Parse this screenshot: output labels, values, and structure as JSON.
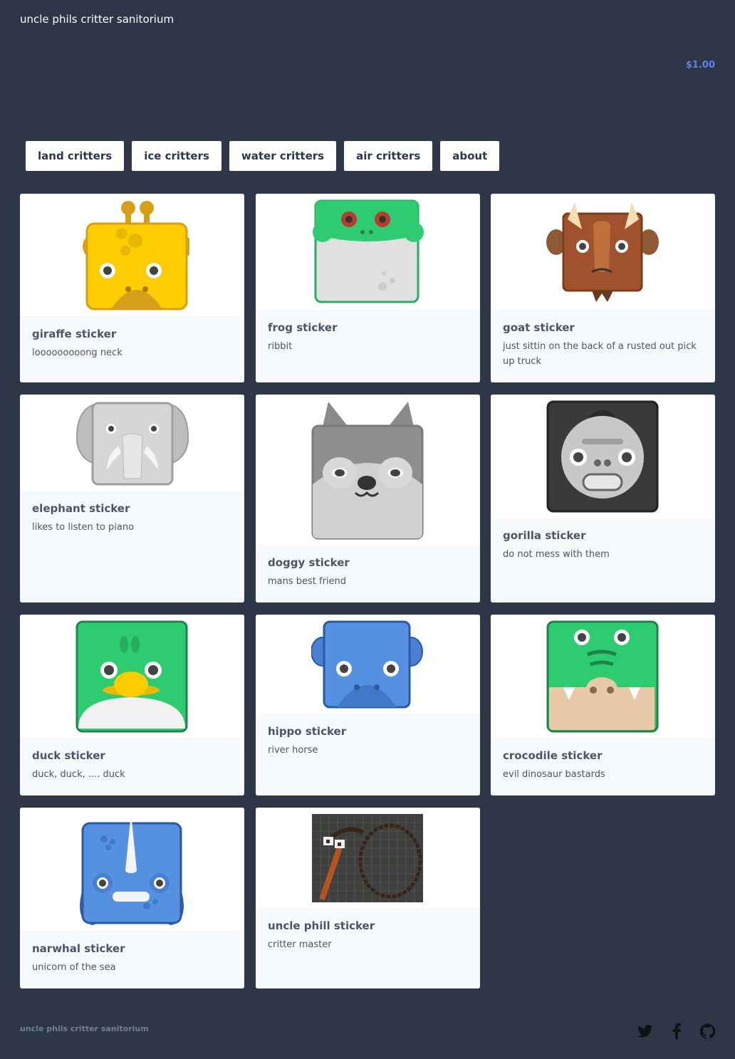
{
  "header": {
    "title": "uncle phils critter sanitorium",
    "cart_total": "$1.00"
  },
  "nav": [
    {
      "label": "land critters"
    },
    {
      "label": "ice critters"
    },
    {
      "label": "water critters"
    },
    {
      "label": "air critters"
    },
    {
      "label": "about"
    }
  ],
  "products": [
    {
      "name": "giraffe sticker",
      "description": "looooooooong neck",
      "icon": "giraffe-icon"
    },
    {
      "name": "frog sticker",
      "description": "ribbit",
      "icon": "frog-icon"
    },
    {
      "name": "goat sticker",
      "description": "just sittin on the back of a rusted out pick up truck",
      "icon": "goat-icon"
    },
    {
      "name": "elephant sticker",
      "description": "likes to listen to piano",
      "icon": "elephant-icon"
    },
    {
      "name": "doggy sticker",
      "description": "mans best friend",
      "icon": "dog-icon"
    },
    {
      "name": "gorilla sticker",
      "description": "do not mess with them",
      "icon": "gorilla-icon"
    },
    {
      "name": "duck sticker",
      "description": "duck, duck, .... duck",
      "icon": "duck-icon"
    },
    {
      "name": "hippo sticker",
      "description": "river horse",
      "icon": "hippo-icon"
    },
    {
      "name": "crocodile sticker",
      "description": "evil dinosaur bastards",
      "icon": "crocodile-icon"
    },
    {
      "name": "narwhal sticker",
      "description": "unicorn of the sea",
      "icon": "narwhal-icon"
    },
    {
      "name": "uncle phill sticker",
      "description": "critter master",
      "icon": "uncle-phill-pixel-art"
    }
  ],
  "footer": {
    "title": "uncle phils critter sanitorium",
    "social_icons": [
      "twitter-icon",
      "facebook-icon",
      "github-icon"
    ]
  },
  "colors": {
    "background": "#2d3748",
    "accent": "#667eea",
    "card_info_bg": "#f7fafc",
    "text_dark": "#4a5568"
  }
}
